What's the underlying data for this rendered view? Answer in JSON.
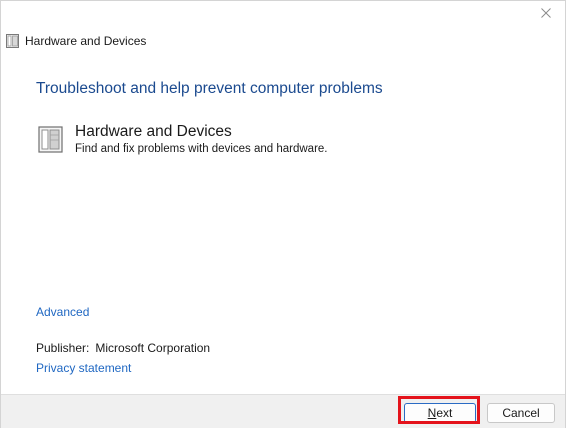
{
  "window": {
    "title": "Hardware and Devices",
    "close_label": "×"
  },
  "main": {
    "heading": "Troubleshoot and help prevent computer problems",
    "item": {
      "title": "Hardware and Devices",
      "description": "Find and fix problems with devices and hardware."
    },
    "advanced_link": "Advanced",
    "publisher_label": "Publisher:",
    "publisher_value": "Microsoft Corporation",
    "privacy_link": "Privacy statement"
  },
  "footer": {
    "next_label": {
      "accelerator": "N",
      "rest": "ext"
    },
    "cancel_label": "Cancel"
  },
  "colors": {
    "heading": "#1b4a8f",
    "link": "#1f67c2",
    "highlight": "#e4131b",
    "footer_bg": "#f0f0f0"
  },
  "icons": {
    "title_icon": "hardware-devices-icon",
    "item_icon": "hardware-devices-icon",
    "close": "close-icon"
  }
}
